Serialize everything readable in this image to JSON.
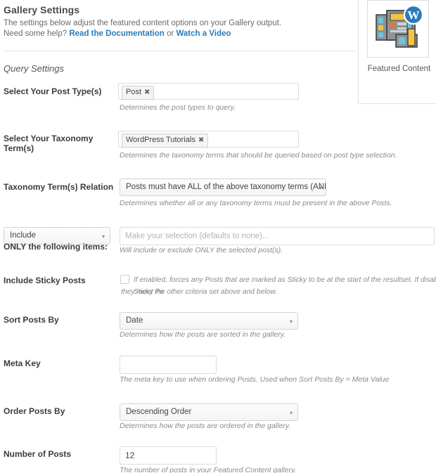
{
  "header": {
    "title": "Gallery Settings",
    "subtitle": "The settings below adjust the featured content options on your Gallery output.",
    "help_prefix": "Need some help? ",
    "help_link1": "Read the Documentation",
    "help_or": " or ",
    "help_link2": "Watch a Video",
    "section_title": "Query Settings",
    "link_color": "#2b7bb9"
  },
  "featured_panel": {
    "caption": "Featured Content",
    "icon": "featured-content-layout-icon"
  },
  "fields": {
    "post_types": {
      "label": "Select Your Post Type(s)",
      "tags": [
        "Post"
      ],
      "description": "Determines the post types to query."
    },
    "taxonomy_terms": {
      "label": "Select Your Taxonomy Term(s)",
      "tags": [
        "WordPress Tutorials"
      ],
      "description": "Determines the taxonomy terms that should be queried based on post type selection."
    },
    "taxonomy_relation": {
      "label": "Taxonomy Term(s) Relation",
      "value": "Posts must have ALL of the above taxonomy terms (AND)",
      "description": "Determines whether all or any taxonomy terms must be present in the above Posts."
    },
    "include_exclude": {
      "mode_value": "Include",
      "label_suffix": "ONLY the following items:",
      "placeholder": "Make your selection (defaults to none)...",
      "description": "Will include or exclude ONLY the selected post(s)."
    },
    "sticky_posts": {
      "label": "Include Sticky Posts",
      "checked": false,
      "description_line1": "If enabled, forces any Posts that are marked as Sticky to be at the start of the resultset. If disabled, Sticky Po",
      "description_line2": "they meet the other criteria set above and below."
    },
    "sort_posts_by": {
      "label": "Sort Posts By",
      "value": "Date",
      "description": "Determines how the posts are sorted in the gallery."
    },
    "meta_key": {
      "label": "Meta Key",
      "value": "",
      "description": "The meta key to use when ordering Posts. Used when Sort Posts By = Meta Value"
    },
    "order_posts_by": {
      "label": "Order Posts By",
      "value": "Descending Order",
      "description": "Determines how the posts are ordered in the gallery."
    },
    "number_of_posts": {
      "label": "Number of Posts",
      "value": "12",
      "description": "The number of posts in your Featured Content gallery."
    }
  },
  "icons": {
    "dropdown_arrow": "▾",
    "chip_remove": "✖"
  }
}
